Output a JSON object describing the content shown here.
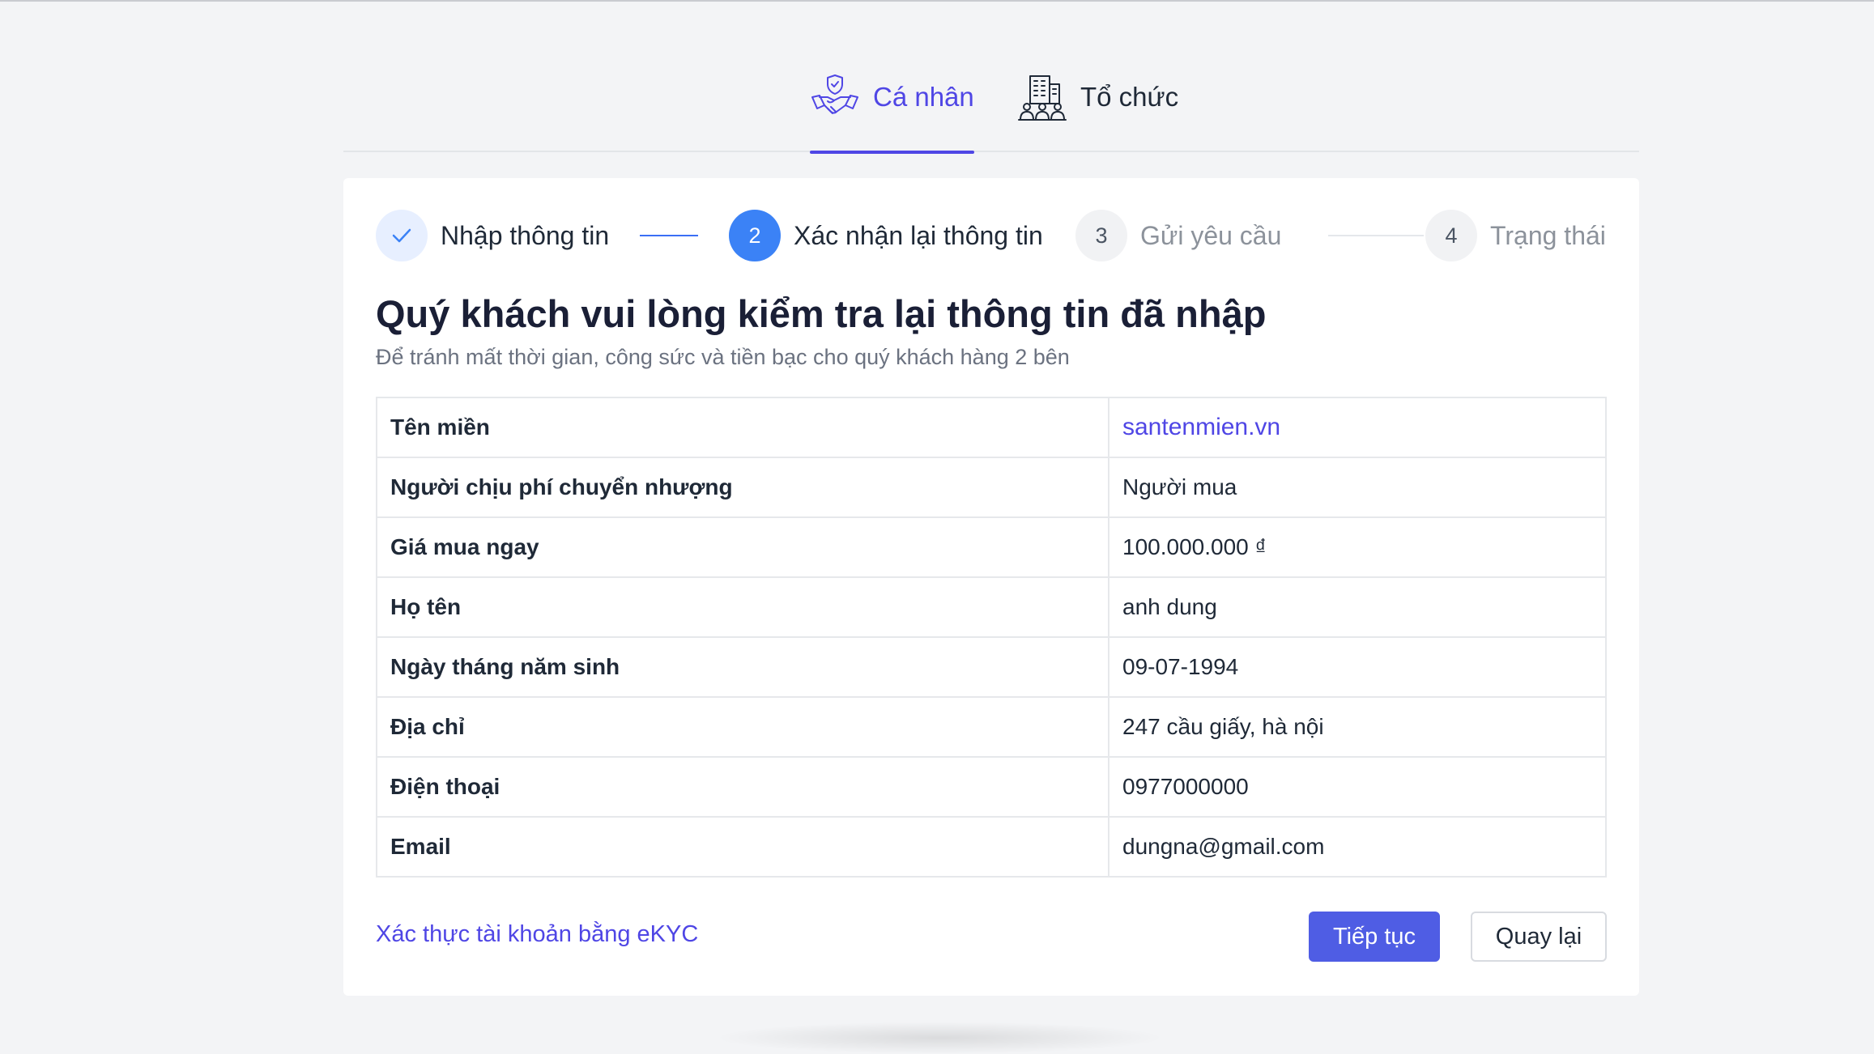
{
  "tabs": [
    {
      "label": "Cá nhân",
      "icon": "handshake-shield-icon",
      "active": true
    },
    {
      "label": "Tổ chức",
      "icon": "building-people-icon",
      "active": false
    }
  ],
  "steps": [
    {
      "label": "Nhập thông tin",
      "number": "",
      "status": "done"
    },
    {
      "label": "Xác nhận lại thông tin",
      "number": "2",
      "status": "active"
    },
    {
      "label": "Gửi yêu cầu",
      "number": "3",
      "status": "pending"
    },
    {
      "label": "Trạng thái",
      "number": "4",
      "status": "pending"
    }
  ],
  "main": {
    "title": "Quý khách vui lòng kiểm tra lại thông tin đã nhập",
    "subtitle": "Để tránh mất thời gian, công sức và tiền bạc cho quý khách hàng 2 bên"
  },
  "info_rows": [
    {
      "label": "Tên miền",
      "value": "santenmien.vn"
    },
    {
      "label": "Người chịu phí chuyển nhượng",
      "value": "Người mua"
    },
    {
      "label": "Giá mua ngay",
      "value": "100.000.000 ₫"
    },
    {
      "label": "Họ tên",
      "value": "anh dung"
    },
    {
      "label": "Ngày tháng năm sinh",
      "value": "09-07-1994"
    },
    {
      "label": "Địa chỉ",
      "value": "247 cầu giấy, hà nội"
    },
    {
      "label": "Điện thoại",
      "value": "0977000000"
    },
    {
      "label": "Email",
      "value": "dungna@gmail.com"
    }
  ],
  "actions": {
    "ekyc_link": "Xác thực tài khoản bằng eKYC",
    "continue_label": "Tiếp tục",
    "back_label": "Quay lại"
  },
  "colors": {
    "accent": "#4f46e5",
    "step_active": "#3b82f6",
    "button_primary": "#4f5de4",
    "background": "#f3f4f6"
  }
}
